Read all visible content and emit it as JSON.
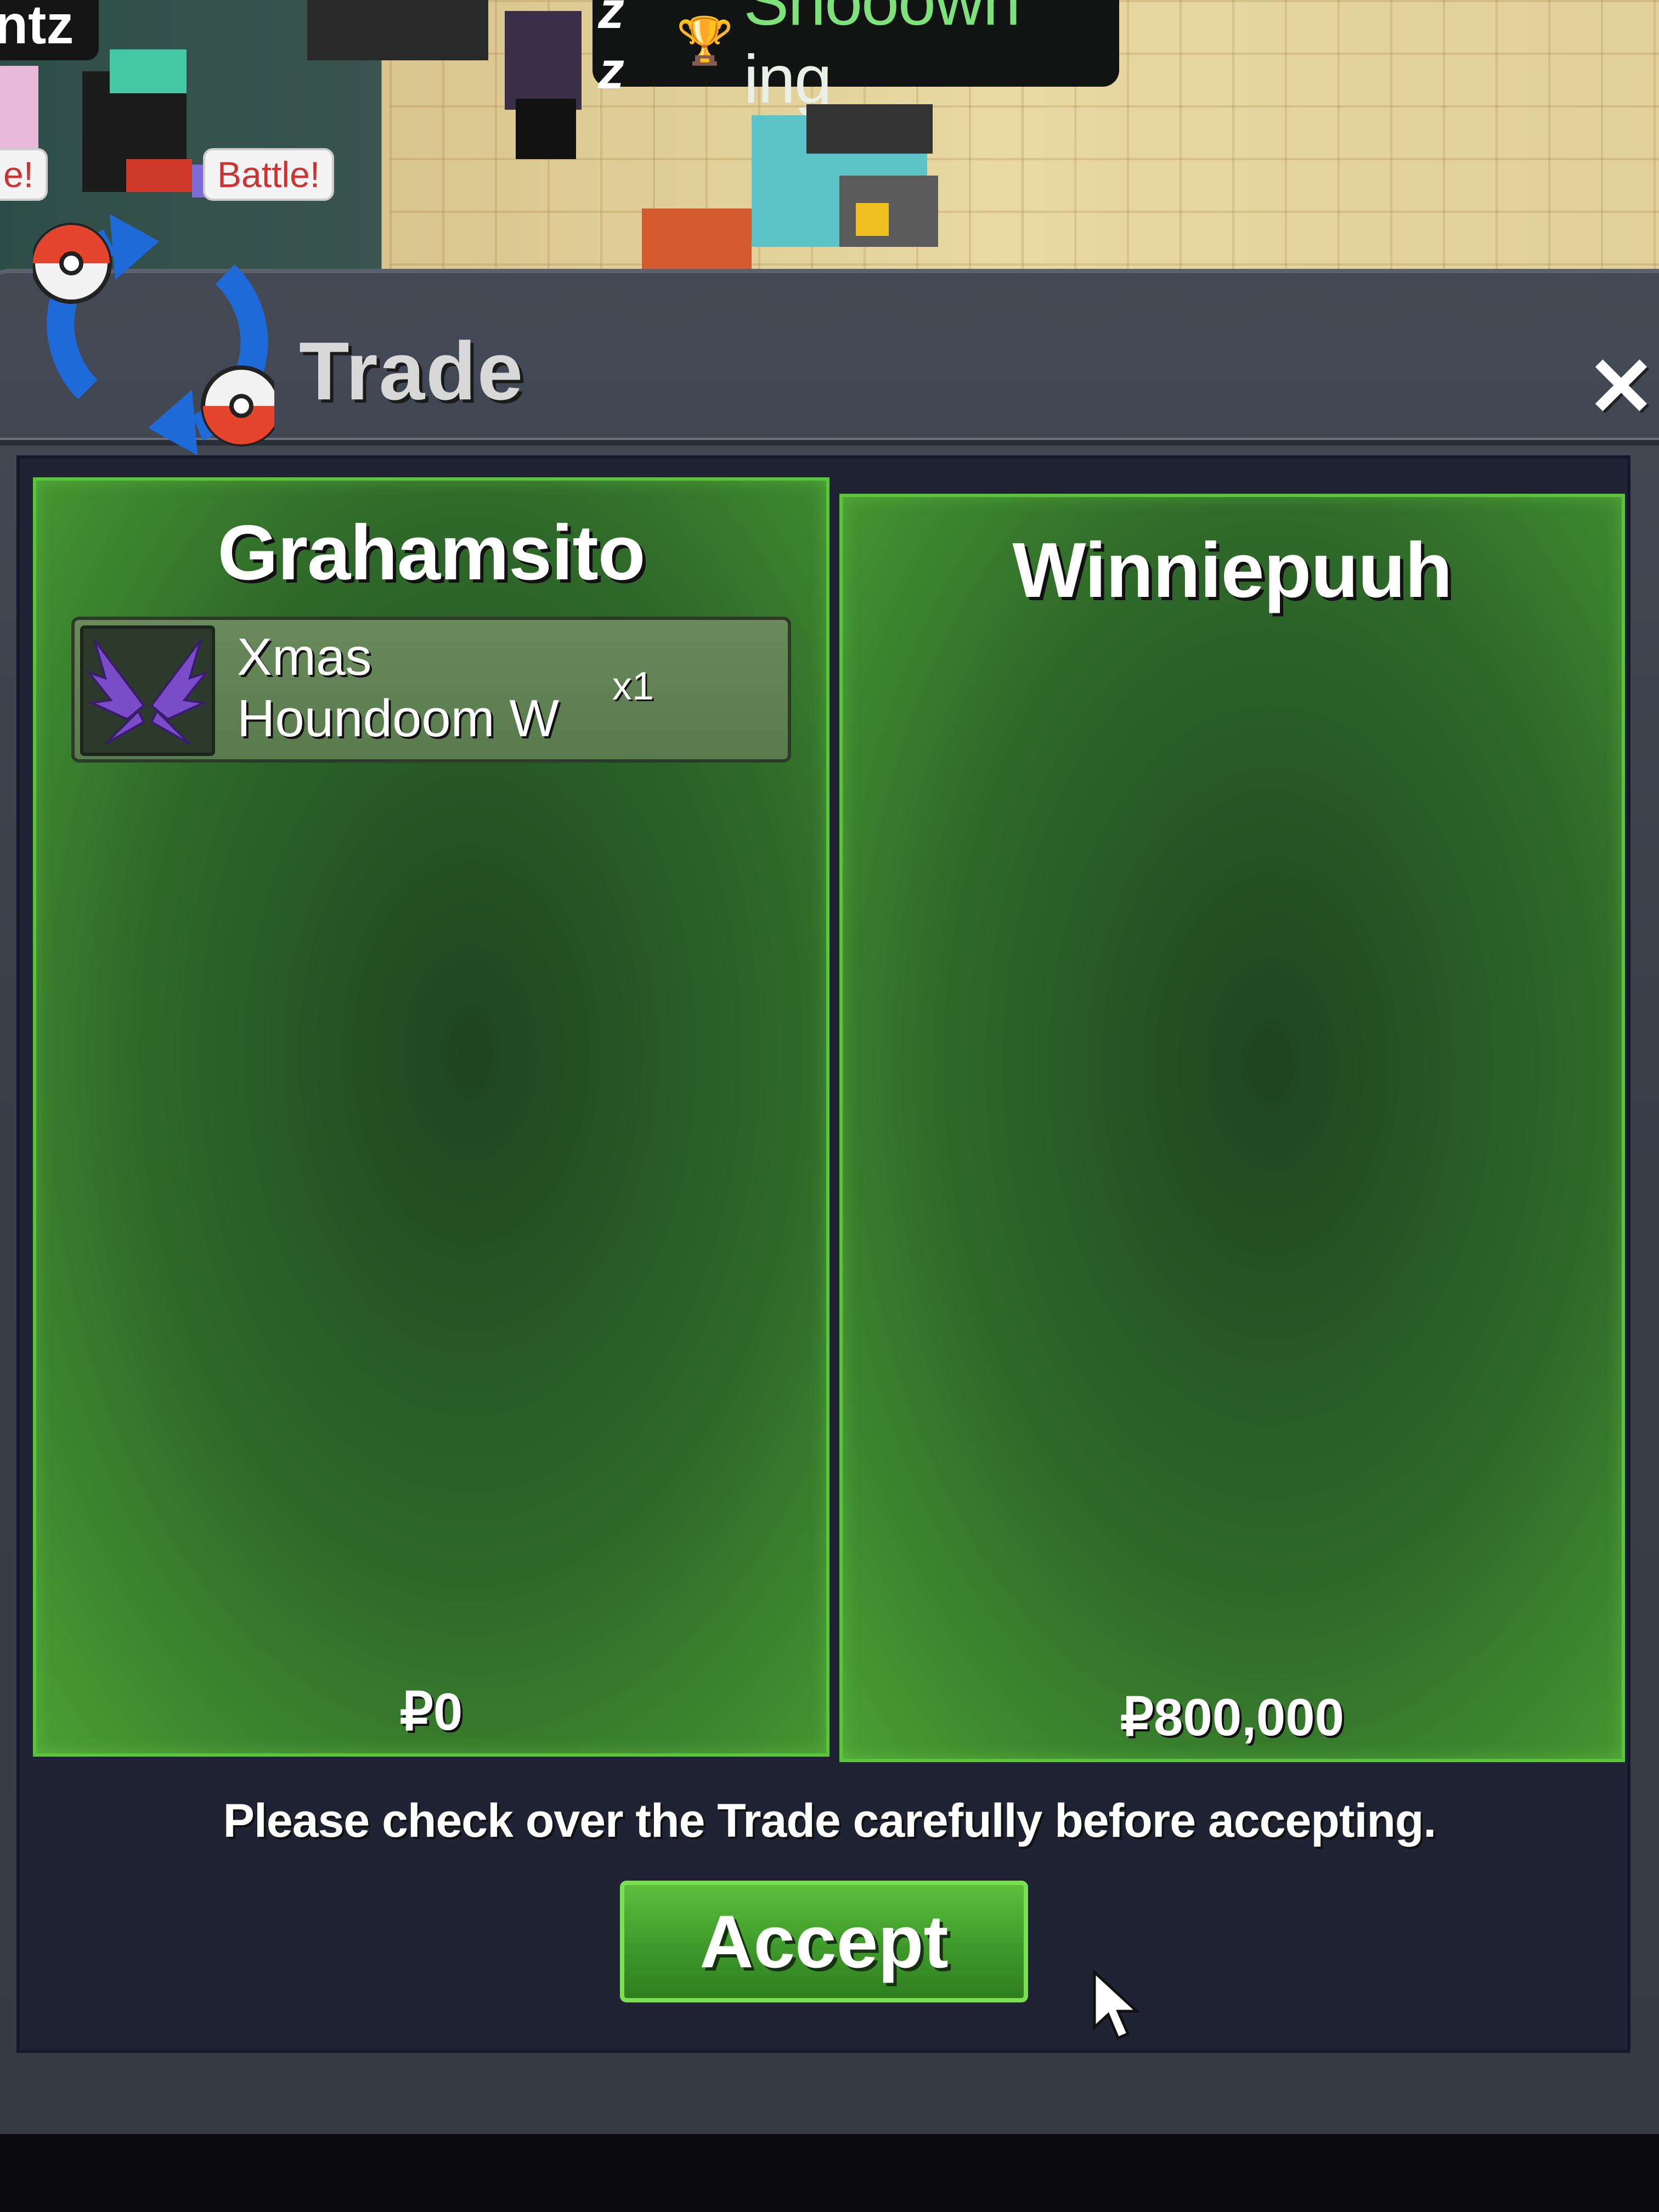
{
  "world": {
    "player_name_fragment": "ntz",
    "speech_left": "e!",
    "speech_right": "Battle!",
    "title_zz": "z z",
    "player_title_name": "Shooown",
    "player_title_suffix": " ing"
  },
  "window": {
    "title": "Trade",
    "close_label": "✕"
  },
  "left_panel": {
    "trader_name": "Grahamsito",
    "items": [
      {
        "name": "Xmas Houndoom W",
        "quantity": "x1",
        "icon": "purple-wings-icon"
      }
    ],
    "money": "₽0"
  },
  "right_panel": {
    "trader_name": "Winniepuuh",
    "items": [],
    "money": "₽800,000"
  },
  "notice": "Please check over the Trade carefully before accepting.",
  "accept_label": "Accept",
  "colors": {
    "panel_green": "#2f6a2a",
    "panel_border": "#5ac43a",
    "accept_green": "#4aa833",
    "title_green": "#7de27a"
  }
}
